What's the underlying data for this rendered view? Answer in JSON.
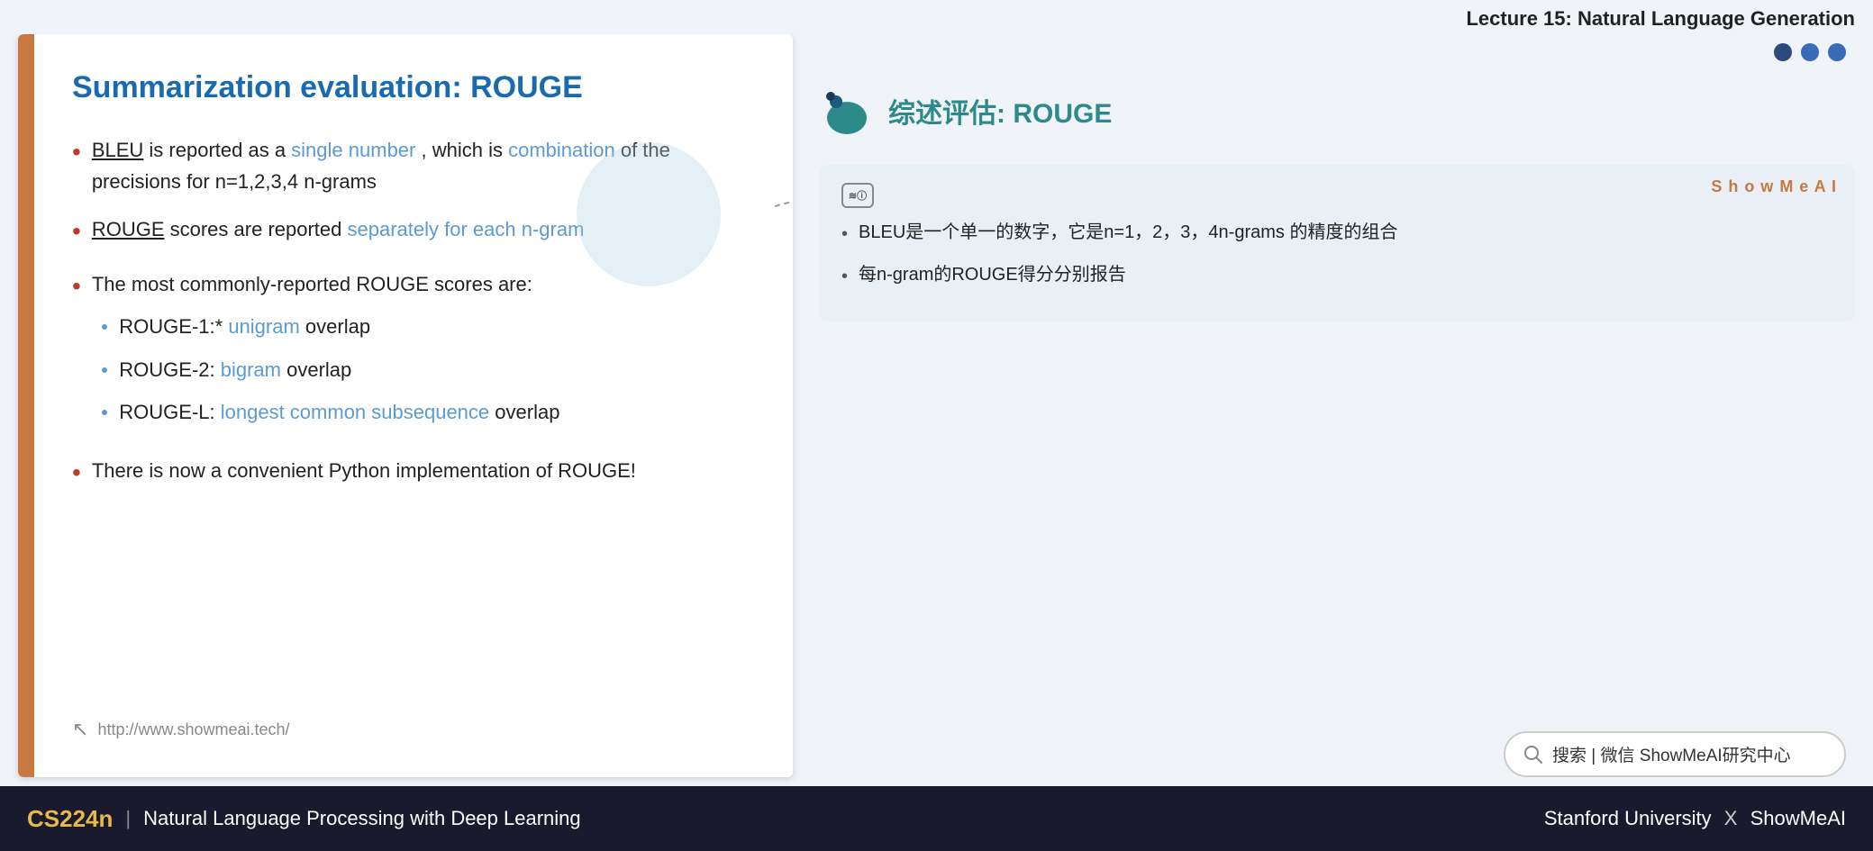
{
  "page": {
    "top_bar": {
      "title": "Lecture 15: Natural Language Generation"
    },
    "slide": {
      "title": "Summarization evaluation: ROUGE",
      "bullets": [
        {
          "id": "bullet1",
          "prefix_underline": "BLEU",
          "text_before": " is reported as a ",
          "highlight1": "single number",
          "text_middle": ", which is ",
          "highlight2": "combination",
          "text_after": " of the precisions for n=1,2,3,4 n-grams"
        },
        {
          "id": "bullet2",
          "prefix_underline": "ROUGE",
          "text_before": " scores are reported ",
          "highlight1": "separately for each n-gram",
          "text_after": ""
        }
      ],
      "sub_section_label": "The most commonly-reported ROUGE scores are:",
      "sub_bullets": [
        {
          "prefix": "ROUGE-1:* ",
          "highlight": "unigram",
          "suffix": " overlap"
        },
        {
          "prefix": "ROUGE-2: ",
          "highlight": "bigram",
          "suffix": " overlap"
        },
        {
          "prefix": "ROUGE-L: ",
          "highlight": "longest common subsequence",
          "suffix": " overlap"
        }
      ],
      "last_bullet": "There is now a convenient Python implementation of ROUGE!",
      "footer_url": "http://www.showmeai.tech/"
    },
    "right": {
      "nav_dots": [
        "dot1",
        "dot2",
        "dot3"
      ],
      "cn_title": "综述评估: ROUGE",
      "translation_card": {
        "ai_icon_text": "≋",
        "showmeai_label": "S h o w M e A I",
        "bullets": [
          "BLEU是一个单一的数字，它是n=1，2，3，4n-grams 的精度的组合",
          "每n-gram的ROUGE得分分别报告"
        ]
      },
      "search_placeholder": "搜索 | 微信 ShowMeAI研究中心"
    },
    "bottom_bar": {
      "cs224n": "CS224n",
      "divider": "|",
      "subtitle": "Natural Language Processing with Deep Learning",
      "right_text": "Stanford University",
      "x_symbol": "X",
      "brand": "ShowMeAI"
    }
  }
}
